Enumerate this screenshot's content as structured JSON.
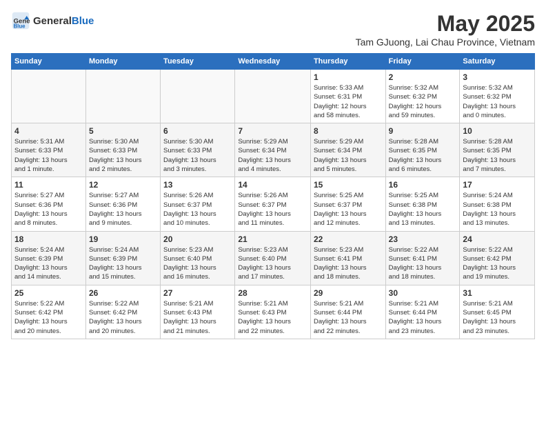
{
  "header": {
    "logo_general": "General",
    "logo_blue": "Blue",
    "title": "May 2025",
    "subtitle": "Tam GJuong, Lai Chau Province, Vietnam"
  },
  "weekdays": [
    "Sunday",
    "Monday",
    "Tuesday",
    "Wednesday",
    "Thursday",
    "Friday",
    "Saturday"
  ],
  "weeks": [
    [
      {
        "day": "",
        "info": ""
      },
      {
        "day": "",
        "info": ""
      },
      {
        "day": "",
        "info": ""
      },
      {
        "day": "",
        "info": ""
      },
      {
        "day": "1",
        "info": "Sunrise: 5:33 AM\nSunset: 6:31 PM\nDaylight: 12 hours\nand 58 minutes."
      },
      {
        "day": "2",
        "info": "Sunrise: 5:32 AM\nSunset: 6:32 PM\nDaylight: 12 hours\nand 59 minutes."
      },
      {
        "day": "3",
        "info": "Sunrise: 5:32 AM\nSunset: 6:32 PM\nDaylight: 13 hours\nand 0 minutes."
      }
    ],
    [
      {
        "day": "4",
        "info": "Sunrise: 5:31 AM\nSunset: 6:33 PM\nDaylight: 13 hours\nand 1 minute."
      },
      {
        "day": "5",
        "info": "Sunrise: 5:30 AM\nSunset: 6:33 PM\nDaylight: 13 hours\nand 2 minutes."
      },
      {
        "day": "6",
        "info": "Sunrise: 5:30 AM\nSunset: 6:33 PM\nDaylight: 13 hours\nand 3 minutes."
      },
      {
        "day": "7",
        "info": "Sunrise: 5:29 AM\nSunset: 6:34 PM\nDaylight: 13 hours\nand 4 minutes."
      },
      {
        "day": "8",
        "info": "Sunrise: 5:29 AM\nSunset: 6:34 PM\nDaylight: 13 hours\nand 5 minutes."
      },
      {
        "day": "9",
        "info": "Sunrise: 5:28 AM\nSunset: 6:35 PM\nDaylight: 13 hours\nand 6 minutes."
      },
      {
        "day": "10",
        "info": "Sunrise: 5:28 AM\nSunset: 6:35 PM\nDaylight: 13 hours\nand 7 minutes."
      }
    ],
    [
      {
        "day": "11",
        "info": "Sunrise: 5:27 AM\nSunset: 6:36 PM\nDaylight: 13 hours\nand 8 minutes."
      },
      {
        "day": "12",
        "info": "Sunrise: 5:27 AM\nSunset: 6:36 PM\nDaylight: 13 hours\nand 9 minutes."
      },
      {
        "day": "13",
        "info": "Sunrise: 5:26 AM\nSunset: 6:37 PM\nDaylight: 13 hours\nand 10 minutes."
      },
      {
        "day": "14",
        "info": "Sunrise: 5:26 AM\nSunset: 6:37 PM\nDaylight: 13 hours\nand 11 minutes."
      },
      {
        "day": "15",
        "info": "Sunrise: 5:25 AM\nSunset: 6:37 PM\nDaylight: 13 hours\nand 12 minutes."
      },
      {
        "day": "16",
        "info": "Sunrise: 5:25 AM\nSunset: 6:38 PM\nDaylight: 13 hours\nand 13 minutes."
      },
      {
        "day": "17",
        "info": "Sunrise: 5:24 AM\nSunset: 6:38 PM\nDaylight: 13 hours\nand 13 minutes."
      }
    ],
    [
      {
        "day": "18",
        "info": "Sunrise: 5:24 AM\nSunset: 6:39 PM\nDaylight: 13 hours\nand 14 minutes."
      },
      {
        "day": "19",
        "info": "Sunrise: 5:24 AM\nSunset: 6:39 PM\nDaylight: 13 hours\nand 15 minutes."
      },
      {
        "day": "20",
        "info": "Sunrise: 5:23 AM\nSunset: 6:40 PM\nDaylight: 13 hours\nand 16 minutes."
      },
      {
        "day": "21",
        "info": "Sunrise: 5:23 AM\nSunset: 6:40 PM\nDaylight: 13 hours\nand 17 minutes."
      },
      {
        "day": "22",
        "info": "Sunrise: 5:23 AM\nSunset: 6:41 PM\nDaylight: 13 hours\nand 18 minutes."
      },
      {
        "day": "23",
        "info": "Sunrise: 5:22 AM\nSunset: 6:41 PM\nDaylight: 13 hours\nand 18 minutes."
      },
      {
        "day": "24",
        "info": "Sunrise: 5:22 AM\nSunset: 6:42 PM\nDaylight: 13 hours\nand 19 minutes."
      }
    ],
    [
      {
        "day": "25",
        "info": "Sunrise: 5:22 AM\nSunset: 6:42 PM\nDaylight: 13 hours\nand 20 minutes."
      },
      {
        "day": "26",
        "info": "Sunrise: 5:22 AM\nSunset: 6:42 PM\nDaylight: 13 hours\nand 20 minutes."
      },
      {
        "day": "27",
        "info": "Sunrise: 5:21 AM\nSunset: 6:43 PM\nDaylight: 13 hours\nand 21 minutes."
      },
      {
        "day": "28",
        "info": "Sunrise: 5:21 AM\nSunset: 6:43 PM\nDaylight: 13 hours\nand 22 minutes."
      },
      {
        "day": "29",
        "info": "Sunrise: 5:21 AM\nSunset: 6:44 PM\nDaylight: 13 hours\nand 22 minutes."
      },
      {
        "day": "30",
        "info": "Sunrise: 5:21 AM\nSunset: 6:44 PM\nDaylight: 13 hours\nand 23 minutes."
      },
      {
        "day": "31",
        "info": "Sunrise: 5:21 AM\nSunset: 6:45 PM\nDaylight: 13 hours\nand 23 minutes."
      }
    ]
  ]
}
